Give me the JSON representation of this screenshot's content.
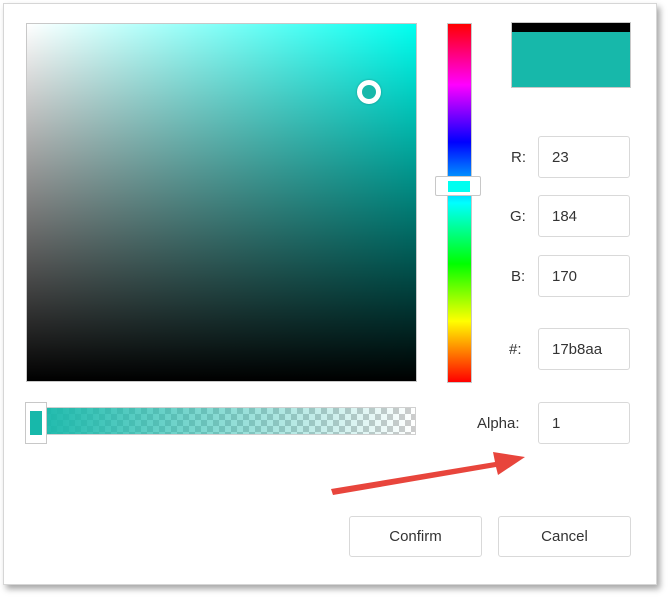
{
  "colors": {
    "hue_base": "#00fff0",
    "selected": "#17b8aa",
    "previous": "#000000",
    "annotation_arrow": "#e8453c"
  },
  "picker": {
    "sv_handle": {
      "saturation": 0.88,
      "value": 0.81
    },
    "hue_position": 0.454,
    "alpha_position": 0.0
  },
  "fields": {
    "r": {
      "label": "R:",
      "value": "23"
    },
    "g": {
      "label": "G:",
      "value": "184"
    },
    "b": {
      "label": "B:",
      "value": "170"
    },
    "hex": {
      "label": "#:",
      "value": "17b8aa"
    },
    "alpha": {
      "label": "Alpha:",
      "value": "1"
    }
  },
  "buttons": {
    "confirm": "Confirm",
    "cancel": "Cancel"
  }
}
